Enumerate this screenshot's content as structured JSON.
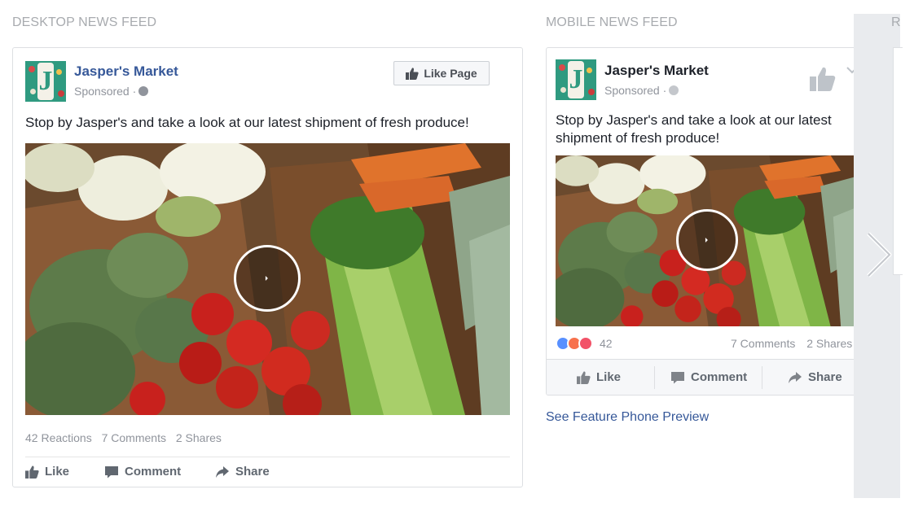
{
  "sections": {
    "desktop_title": "DESKTOP NEWS FEED",
    "mobile_title": "MOBILE NEWS FEED",
    "cut_title": "R"
  },
  "desktop": {
    "page_name": "Jasper's Market",
    "sponsored": "Sponsored ·",
    "like_page_label": "Like Page",
    "post_text": "Stop by Jasper's and take a look at our latest shipment of fresh produce!",
    "stats": {
      "reactions": "42 Reactions",
      "comments": "7 Comments",
      "shares": "2 Shares"
    },
    "actions": {
      "like": "Like",
      "comment": "Comment",
      "share": "Share"
    }
  },
  "mobile": {
    "page_name": "Jasper's Market",
    "sponsored": "Sponsored ·",
    "post_text": "Stop by Jasper's and take a look at our latest shipment of fresh produce!",
    "reaction_count": "42",
    "comments": "7 Comments",
    "shares": "2 Shares",
    "actions": {
      "like": "Like",
      "comment": "Comment",
      "share": "Share"
    }
  },
  "see_feature_phone": "See Feature Phone Preview",
  "colors": {
    "link_blue": "#365899",
    "muted_gray": "#90949c",
    "logo_green": "#2f9a80",
    "like_blue": "#5890ff",
    "angry_orange": "#f7714c",
    "love_red": "#f25268"
  },
  "icons": [
    "thumbs-up-icon",
    "comment-icon",
    "share-icon",
    "globe-icon",
    "play-icon",
    "chevron-right-icon",
    "chevron-down-icon"
  ]
}
